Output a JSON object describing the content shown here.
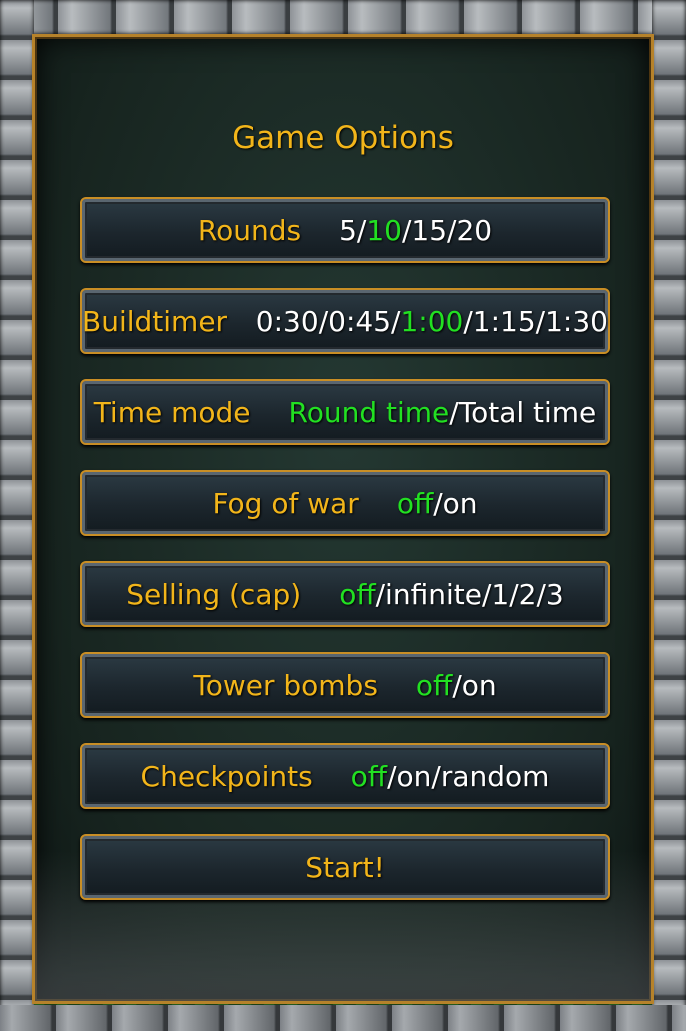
{
  "title": "Game Options",
  "colors": {
    "label": "#f2b51a",
    "selected": "#22e022",
    "option": "#ffffff",
    "frame": "#c98e25"
  },
  "rounds": {
    "label": "Rounds",
    "opts": [
      "5",
      "10",
      "15",
      "20"
    ],
    "selected": "10"
  },
  "buildtimer": {
    "label": "Buildtimer",
    "opts": [
      "0:30",
      "0:45",
      "1:00",
      "1:15",
      "1:30"
    ],
    "selected": "1:00"
  },
  "timemode": {
    "label": "Time mode",
    "opts": [
      "Round time",
      "Total time"
    ],
    "selected": "Round time"
  },
  "fog": {
    "label": "Fog of war",
    "opts": [
      "off",
      "on"
    ],
    "selected": "off"
  },
  "selling": {
    "label": "Selling (cap)",
    "opts": [
      "off",
      "infinite",
      "1",
      "2",
      "3"
    ],
    "selected": "off"
  },
  "towerbombs": {
    "label": "Tower bombs",
    "opts": [
      "off",
      "on"
    ],
    "selected": "off"
  },
  "checkpoints": {
    "label": "Checkpoints",
    "opts": [
      "off",
      "on",
      "random"
    ],
    "selected": "off"
  },
  "start": {
    "label": "Start!"
  }
}
